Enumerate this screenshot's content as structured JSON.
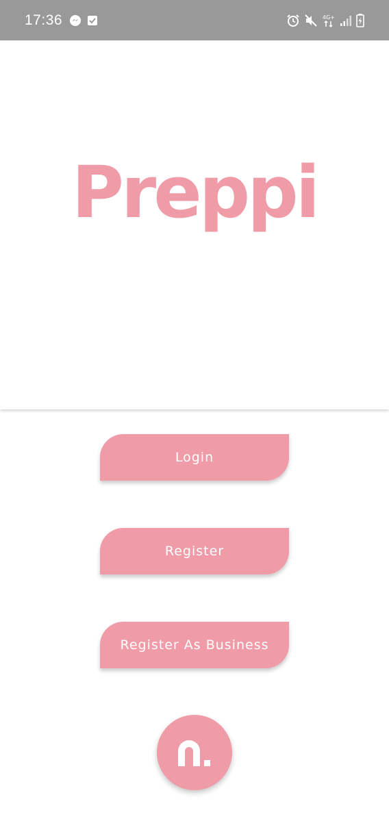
{
  "status_bar": {
    "time": "17:36",
    "left_icons": [
      "messenger-icon",
      "checkbox-icon"
    ],
    "right_icons": [
      "alarm-icon",
      "mute-icon",
      "network-4g-icon",
      "signal-icon",
      "battery-charging-icon"
    ],
    "network_label": "4G+"
  },
  "app": {
    "logo_text": "Preppi",
    "brand_color": "#f09ca8"
  },
  "buttons": {
    "login": "Login",
    "register": "Register",
    "register_business": "Register As Business"
  },
  "fab": {
    "icon": "n-logo-icon"
  }
}
